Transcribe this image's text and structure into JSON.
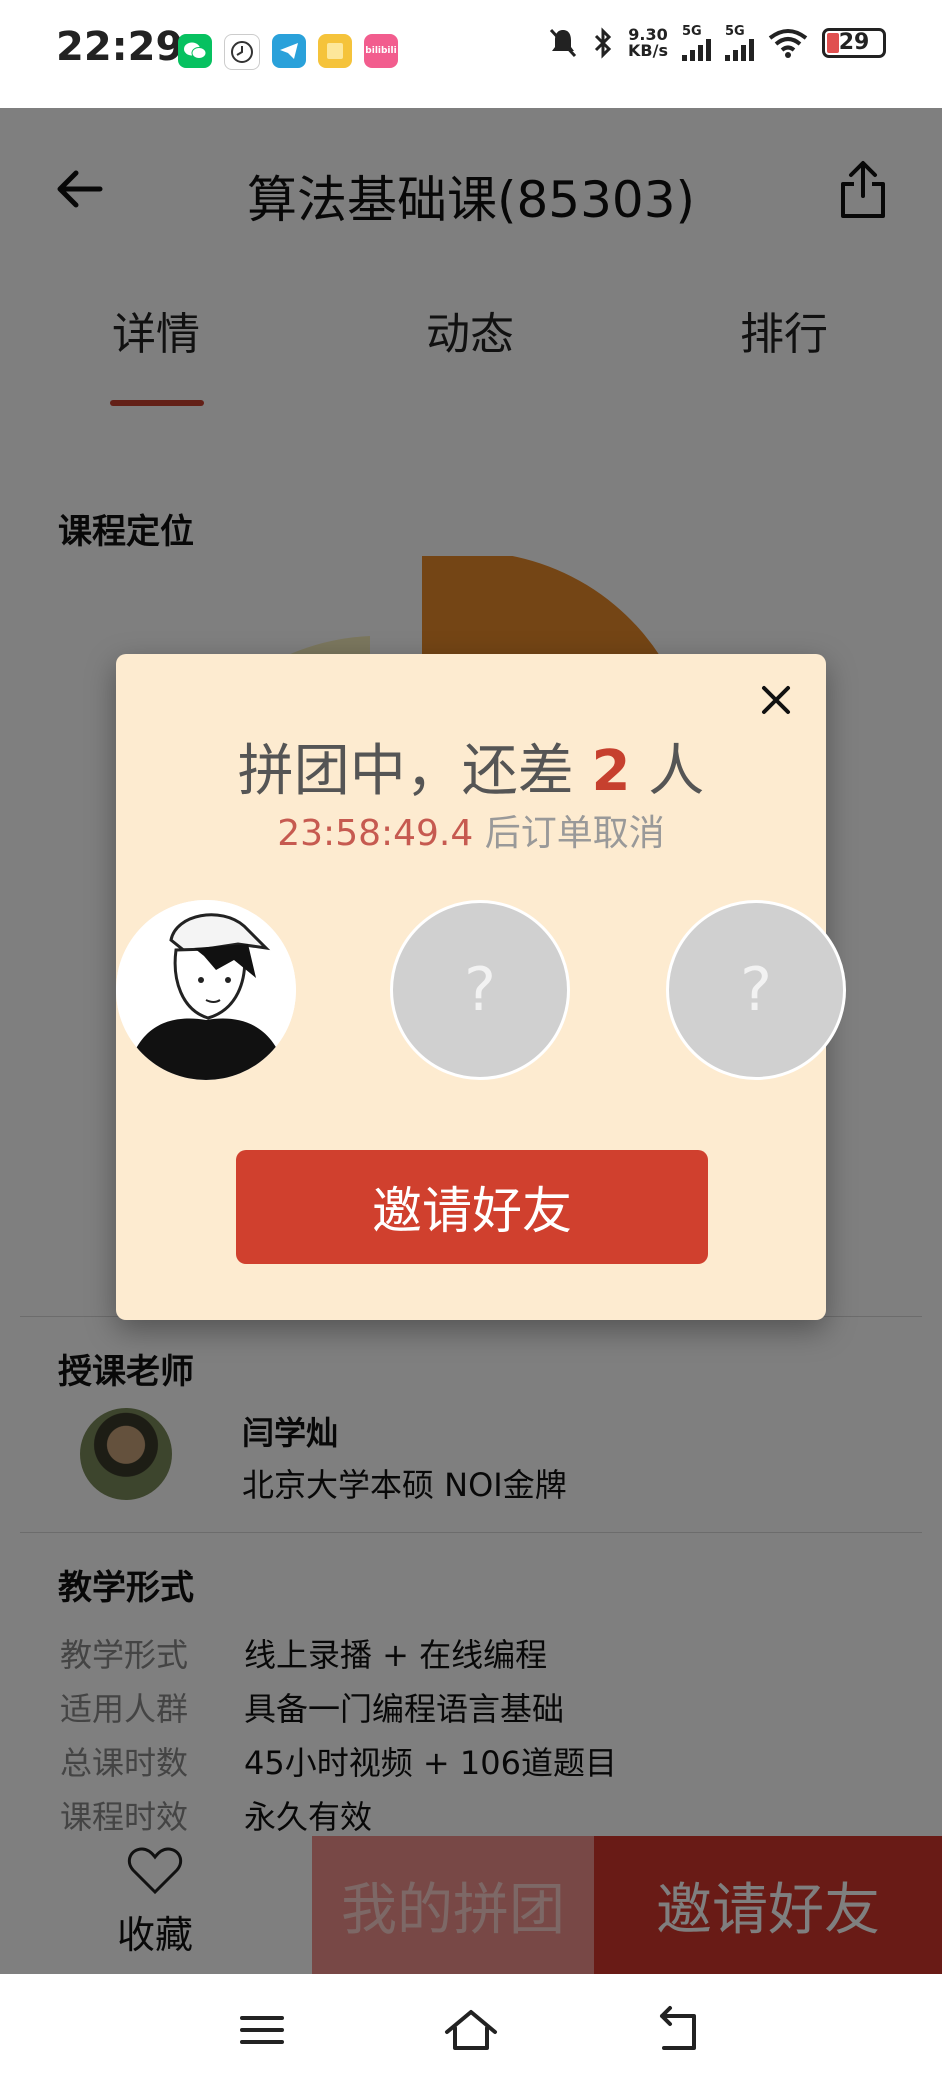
{
  "status": {
    "time": "22:29",
    "apps": [
      {
        "name": "wechat-icon",
        "color": "#07c160",
        "label": ""
      },
      {
        "name": "clock-icon",
        "color": "#ffffff",
        "label": ""
      },
      {
        "name": "telegram-icon",
        "color": "#2aa1da",
        "label": ""
      },
      {
        "name": "notes-icon",
        "color": "#f5c33b",
        "label": ""
      },
      {
        "name": "bilibili-icon",
        "color": "#f25d8e",
        "label": "bilibili"
      }
    ],
    "speed_value": "9.30",
    "speed_unit": "KB/s",
    "net1": "5G",
    "net2": "5G",
    "battery": "29"
  },
  "header": {
    "title": "算法基础课(85303)"
  },
  "tabs": [
    {
      "label": "详情"
    },
    {
      "label": "动态"
    },
    {
      "label": "排行"
    }
  ],
  "sections": {
    "positioning_title": "课程定位",
    "teacher_title": "授课老师",
    "format_title": "教学形式"
  },
  "teacher": {
    "name": "闫学灿",
    "desc": "北京大学本硕  NOI金牌"
  },
  "details": [
    {
      "label": "教学形式",
      "value": "线上录播 + 在线编程"
    },
    {
      "label": "适用人群",
      "value": "具备一门编程语言基础"
    },
    {
      "label": "总课时数",
      "value": "45小时视频 + 106道题目"
    },
    {
      "label": "课程时效",
      "value": "永久有效"
    }
  ],
  "bottom": {
    "favorite_label": "收藏",
    "my_group_label": "我的拼团",
    "invite_label": "邀请好友"
  },
  "modal": {
    "title_prefix": "拼团中，还差 ",
    "remaining": "2",
    "title_suffix": " 人",
    "countdown": "23:58:49.4",
    "countdown_suffix": " 后订单取消",
    "empty_slot_mark": "?",
    "invite_button": "邀请好友"
  },
  "colors": {
    "accent": "#c6402e",
    "modal_bg": "#fdebd0",
    "button": "#d0402e"
  }
}
